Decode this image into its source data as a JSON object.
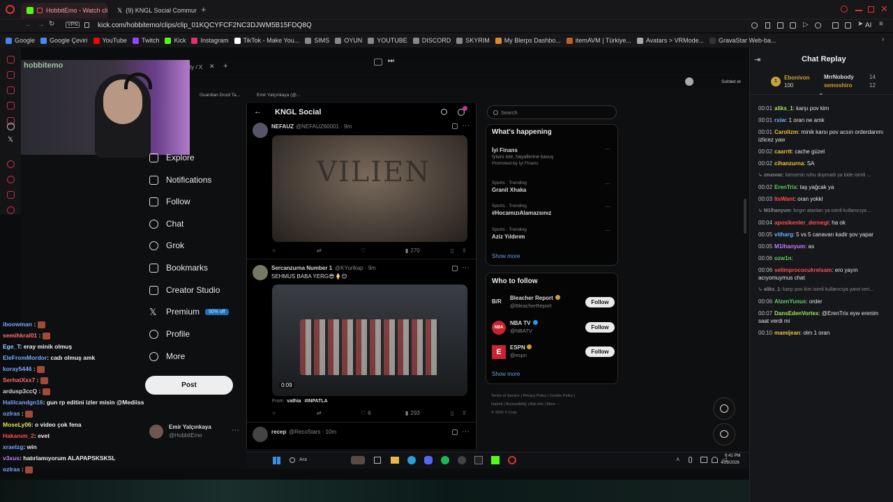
{
  "browser": {
    "tabs": [
      {
        "label": "HobbitEmo - Watch clip",
        "active": true
      },
      {
        "label": "(9) KNGL Social Communi",
        "active": false
      }
    ],
    "new_tab": "+",
    "url": "kick.com/hobbitemo/clips/clip_01KQCYFCF2NC3DJWM5B15FDQ8Q",
    "vpn": "VPN",
    "ai_label": "AI"
  },
  "bookmarks": [
    {
      "label": "Google",
      "color": "#4285f4"
    },
    {
      "label": "Google Çeviri",
      "color": "#4a8af4"
    },
    {
      "label": "YouTube",
      "color": "#ff0000"
    },
    {
      "label": "Twitch",
      "color": "#9146ff"
    },
    {
      "label": "Kick",
      "color": "#53fc18"
    },
    {
      "label": "Instagram",
      "color": "#e1306c"
    },
    {
      "label": "TikTok - Make You...",
      "color": "#ffffff"
    },
    {
      "label": "SIMS",
      "color": "#888888"
    },
    {
      "label": "OYUN",
      "color": "#888888"
    },
    {
      "label": "YOUTUBE",
      "color": "#888888"
    },
    {
      "label": "DISCORD",
      "color": "#888888"
    },
    {
      "label": "SKYRIM",
      "color": "#888888"
    },
    {
      "label": "My Blerps Dashbo...",
      "color": "#e08a2a"
    },
    {
      "label": "itemAVM | Türkiye...",
      "color": "#c0602a"
    },
    {
      "label": "Avatars > VRMode...",
      "color": "#aaaaaa"
    },
    {
      "label": "GravaStar Web-ba...",
      "color": "#333333"
    }
  ],
  "stream": {
    "watermark": "hobbitemo",
    "inner_tab": "ty / X",
    "inner_bookmarks": [
      "Guardian Druid Ta...",
      "Emir Yalçınkaya (@..."
    ],
    "inner_right": "Sohbet et"
  },
  "x": {
    "nav": [
      "Explore",
      "Notifications",
      "Follow",
      "Chat",
      "Grok",
      "Bookmarks",
      "Creator Studio",
      "Premium",
      "Profile",
      "More"
    ],
    "premium_badge": "50% off",
    "post_button": "Post",
    "profile": {
      "name": "Emir Yalçınkaya",
      "handle": "@HobbitEmo"
    },
    "feed_title": "KNGL Social",
    "search_placeholder": "Search",
    "tweets": [
      {
        "name": "NEFAUZ",
        "handle": "@NEFAUZ60001 · 9m",
        "image": "VILIEN",
        "views": "270"
      },
      {
        "name": "Sercanzurna Number 1",
        "handle": "@KYurtkap · 9m",
        "text": "SEHMUS BABA YERG😎🍦😊",
        "video_time": "0:09",
        "from": "From",
        "from_user": "vathia",
        "from_tag": "#INPATLA",
        "likes": "6",
        "views": "293"
      },
      {
        "name": "recep",
        "handle": "@RecoStars · 10m"
      }
    ],
    "happening": {
      "title": "What's happening",
      "items": [
        {
          "top": "İyi Finans",
          "sub": "İyisini iste, hayallerine kavuş",
          "meta": "Promoted by İyi Finans"
        },
        {
          "top": "Sports · Trending",
          "sub": "Granit Xhaka"
        },
        {
          "top": "Sports · Trending",
          "sub": "#HocamızıAlamazsınız"
        },
        {
          "top": "Sports · Trending",
          "sub": "Aziz Yıldırım"
        }
      ],
      "show_more": "Show more"
    },
    "who_to_follow": {
      "title": "Who to follow",
      "accounts": [
        {
          "name": "Bleacher Report",
          "handle": "@BleacherReport",
          "logo": "B/R"
        },
        {
          "name": "NBA TV",
          "handle": "@NBATV",
          "logo": "NBA"
        },
        {
          "name": "ESPN",
          "handle": "@espn",
          "logo": "E"
        }
      ],
      "follow_label": "Follow",
      "show_more": "Show more"
    },
    "footer": [
      "Terms of Service",
      "Privacy Policy",
      "Cookie Policy",
      "Imprint",
      "Accessibility",
      "Ads info",
      "More ···",
      "© 2026 X Corp."
    ]
  },
  "taskbar": {
    "search": "Ara",
    "time": "6:41 PM",
    "date": "4/29/2026"
  },
  "overlay_chat": [
    {
      "user": "iboowman",
      "msg": "",
      "color": "#7aa6ff"
    },
    {
      "user": "semihkral01",
      "msg": "",
      "color": "#ff7070"
    },
    {
      "user": "Ege_T",
      "msg": ": eray minik olmuş",
      "color": "#9ad1ff"
    },
    {
      "user": "EleFromMordor",
      "msg": ": cadı olmuş amk",
      "color": "#6fb0ff"
    },
    {
      "user": "koray5446",
      "msg": "",
      "color": "#7aa6ff"
    },
    {
      "user": "SerhatXxx7",
      "msg": "",
      "color": "#ff6a6a"
    },
    {
      "user": "ardusp3ccQ",
      "msg": "",
      "color": "#d6d6d6"
    },
    {
      "user": "Halilcandgn16",
      "msg": ": gun rp editini izler misin @Mediiss",
      "color": "#7aa6ff"
    },
    {
      "user": "ozlras",
      "msg": "",
      "color": "#7aa6ff"
    },
    {
      "user": "MoseLy06",
      "msg": ": o video çok fena",
      "color": "#e0e060"
    },
    {
      "user": "Hakanım_2",
      "msg": ": evet",
      "color": "#ff5050"
    },
    {
      "user": "xraelzg",
      "msg": ": win",
      "color": "#7aa6ff"
    },
    {
      "user": "v3xus",
      "msg": ": hatırlamıyorum ALAPAPSKSKSL",
      "color": "#c080ff"
    },
    {
      "user": "ozlras",
      "msg": "",
      "color": "#7aa6ff"
    }
  ],
  "chat_replay": {
    "title": "Chat Replay",
    "gifters": [
      {
        "name": "Ebonivon",
        "amount": "100"
      },
      {
        "name": "MrrNobody",
        "amount": "14"
      },
      {
        "name": "semoshiro",
        "amount": "12"
      }
    ],
    "messages": [
      {
        "time": "00:01",
        "user": "aliks_1",
        "msg": ": karşı pov kim",
        "color": "#a0e060"
      },
      {
        "time": "00:01",
        "user": "rxiw",
        "msg": ": 1 oran ne amk",
        "color": "#6ab0ff"
      },
      {
        "time": "00:01",
        "user": "Carolizm",
        "msg": ": minik karsı pov acsın orderdanmı izlicez yaw",
        "color": "#f0c040"
      },
      {
        "time": "00:02",
        "user": "caarrtt",
        "msg": ": cache güzel",
        "color": "#f0c040"
      },
      {
        "time": "00:02",
        "user": "cihanzurna",
        "msg": ": SA",
        "color": "#f0c040"
      },
      {
        "time": "",
        "user": "zeusvac",
        "msg": ": kimsenin ruhu duymadı ya bide isimli ...",
        "color": "#8a8a8a",
        "reply": true
      },
      {
        "time": "00:02",
        "user": "ErenTrix",
        "msg": ": taş yağcak ya",
        "color": "#60d060"
      },
      {
        "time": "00:03",
        "user": "ItsWant",
        "msg": ": oran yokkl",
        "color": "#ff5050"
      },
      {
        "time": "",
        "user": "M1lhanyum",
        "msg": ": kırgın atanları ya isimli kullanıcıya ...",
        "color": "#8a8a8a",
        "reply": true
      },
      {
        "time": "00:04",
        "user": "aposikenler_dernegi",
        "msg": ": ha ok",
        "color": "#ff5050"
      },
      {
        "time": "00:05",
        "user": "vitharg",
        "msg": ": 5 vs 5 canavarı kadir şov yapar",
        "color": "#6ab0ff"
      },
      {
        "time": "00:05",
        "user": "M1lhanyum",
        "msg": ": as",
        "color": "#c080ff"
      },
      {
        "time": "00:06",
        "user": "ozw1n",
        "msg": ":",
        "color": "#60d060"
      },
      {
        "time": "00:06",
        "user": "selimprococukrelsam",
        "msg": ": ero yayın acıyomuymus chat",
        "color": "#ff5050"
      },
      {
        "time": "",
        "user": "aliks_1",
        "msg": ": karşı pov kim isimli kullanıcıya yanıt veri...",
        "color": "#8a8a8a",
        "reply": true
      },
      {
        "time": "00:06",
        "user": "AlzenYunus",
        "msg": ": order",
        "color": "#60d060"
      },
      {
        "time": "00:07",
        "user": "DansEdenVortex",
        "msg": ": @ErenTrix eyw erenim saat verdi mi",
        "color": "#a0e060"
      },
      {
        "time": "00:10",
        "user": "mamijean",
        "msg": ": olm 1 oran",
        "color": "#f0c040"
      }
    ]
  }
}
